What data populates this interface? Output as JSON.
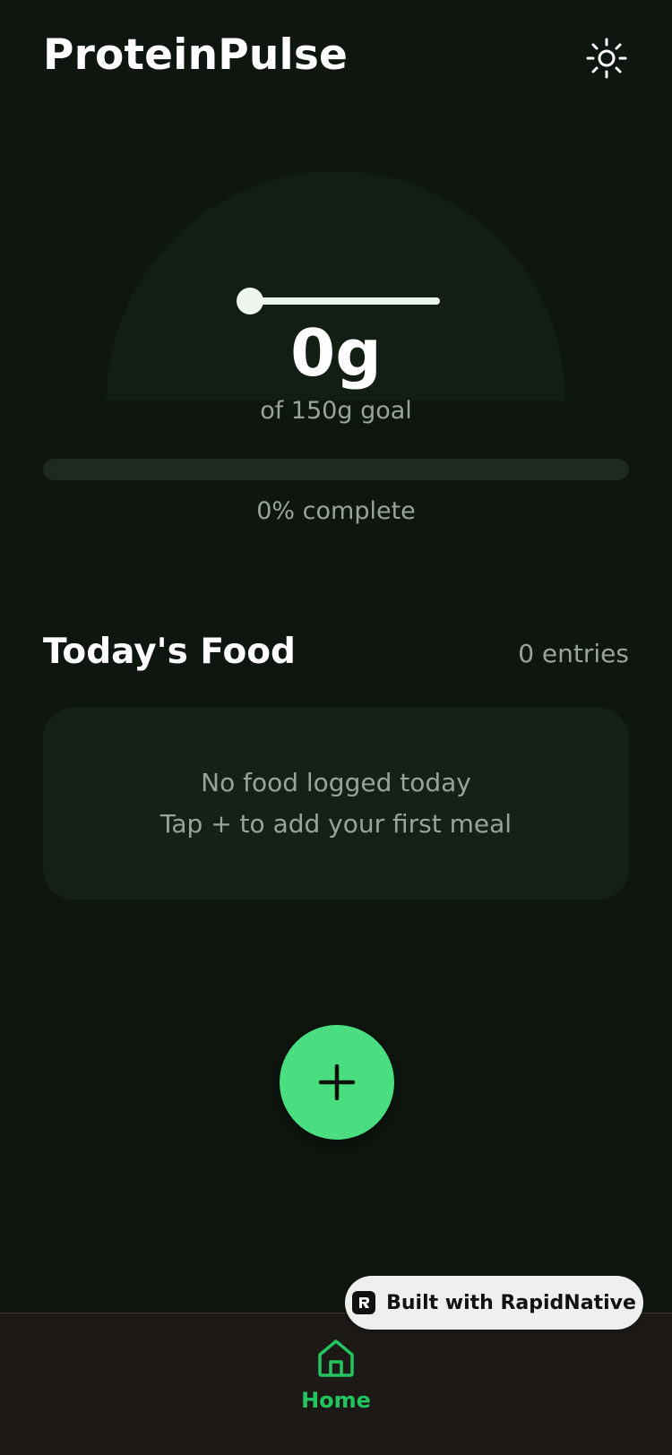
{
  "header": {
    "title": "ProteinPulse",
    "theme_toggle_icon": "sun-icon"
  },
  "gauge": {
    "value_text": "0g",
    "goal_text": "of 150g goal",
    "consumed_g": 0,
    "goal_g": 150
  },
  "progress": {
    "percent": 0,
    "text": "0% complete"
  },
  "food_section": {
    "title": "Today's Food",
    "entries_text": "0 entries",
    "empty_line1": "No food logged today",
    "empty_line2": "Tap + to add your first meal"
  },
  "fab": {
    "icon": "plus-icon"
  },
  "bottom_nav": {
    "items": [
      {
        "label": "Home",
        "icon": "home-icon",
        "active": true
      }
    ]
  },
  "badge": {
    "text": "Built with RapidNative",
    "icon": "rapidnative-logo-icon"
  },
  "colors": {
    "background": "#0e160f",
    "accent": "#4ade80",
    "accent_dark": "#22c55e",
    "muted_text": "#9aa39b",
    "card": "#152018"
  }
}
